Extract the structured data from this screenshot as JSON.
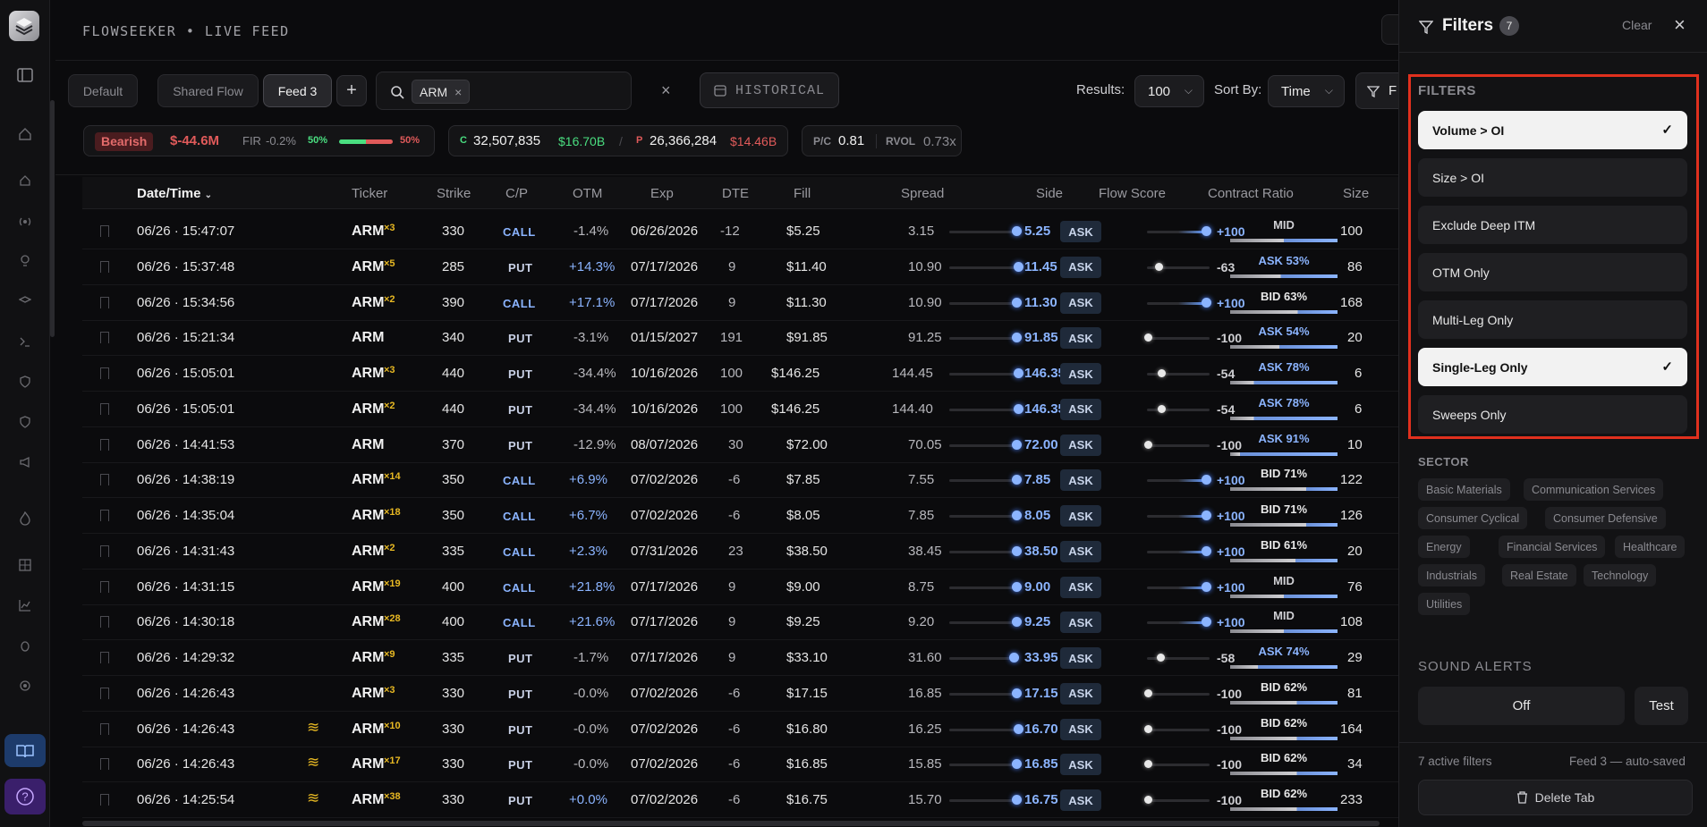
{
  "app": {
    "brand": "FLOWSEEKER • LIVE FEED"
  },
  "tabs": [
    {
      "label": "Default"
    },
    {
      "label": "Shared Flow"
    },
    {
      "label": "Feed 3"
    }
  ],
  "search": {
    "chip": "ARM",
    "historical_label": "HISTORICAL"
  },
  "controls": {
    "results_label": "Results:",
    "results_value": "100",
    "sort_label": "Sort By:",
    "sort_value": "Time",
    "filter_button_partial": "F"
  },
  "summary": {
    "sentiment": "Bearish",
    "net": "$-44.6M",
    "fir_label": "FIR",
    "fir_value": "-0.2%",
    "left_pct": "50%",
    "right_pct": "50%",
    "call_label": "C",
    "call_count": "32,507,835",
    "call_prem": "$16.70B",
    "divider": "/",
    "put_label": "P",
    "put_count": "26,366,284",
    "put_prem": "$14.46B",
    "pc_label": "P/C",
    "pc_value": "0.81",
    "rvol_label": "RVOL",
    "rvol_value": "0.73x"
  },
  "columns": [
    "Date/Time",
    "Ticker",
    "Strike",
    "C/P",
    "OTM",
    "Exp",
    "DTE",
    "Fill",
    "Spread",
    "Side",
    "Flow Score",
    "Contract Ratio",
    "Size"
  ],
  "rows": [
    {
      "dt": "06/26 · 15:47:07",
      "ticker": "ARM",
      "mult": "×3",
      "sweep": "",
      "strike": "330",
      "cp": "CALL",
      "otm": "-1.4%",
      "exp": "06/26/2026",
      "dte": "-12",
      "fill": "$5.25",
      "spread": "3.15",
      "last": "5.25",
      "side": "ASK",
      "score": "+100",
      "ratio": "MID",
      "size": "100"
    },
    {
      "dt": "06/26 · 15:37:48",
      "ticker": "ARM",
      "mult": "×5",
      "sweep": "",
      "strike": "285",
      "cp": "PUT",
      "otm": "+14.3%",
      "exp": "07/17/2026",
      "dte": "9",
      "fill": "$11.40",
      "spread": "10.90",
      "last": "11.45",
      "side": "ASK",
      "score": "-63",
      "ratio": "ASK 53%",
      "size": "86"
    },
    {
      "dt": "06/26 · 15:34:56",
      "ticker": "ARM",
      "mult": "×2",
      "sweep": "",
      "strike": "390",
      "cp": "CALL",
      "otm": "+17.1%",
      "exp": "07/17/2026",
      "dte": "9",
      "fill": "$11.30",
      "spread": "10.90",
      "last": "11.30",
      "side": "ASK",
      "score": "+100",
      "ratio": "BID 63%",
      "size": "168"
    },
    {
      "dt": "06/26 · 15:21:34",
      "ticker": "ARM",
      "mult": "",
      "sweep": "",
      "strike": "340",
      "cp": "PUT",
      "otm": "-3.1%",
      "exp": "01/15/2027",
      "dte": "191",
      "fill": "$91.85",
      "spread": "91.25",
      "last": "91.85",
      "side": "ASK",
      "score": "-100",
      "ratio": "ASK 54%",
      "size": "20"
    },
    {
      "dt": "06/26 · 15:05:01",
      "ticker": "ARM",
      "mult": "×3",
      "sweep": "",
      "strike": "440",
      "cp": "PUT",
      "otm": "-34.4%",
      "exp": "10/16/2026",
      "dte": "100",
      "fill": "$146.25",
      "spread": "144.45",
      "last": "146.35",
      "side": "ASK",
      "score": "-54",
      "ratio": "ASK 78%",
      "size": "6"
    },
    {
      "dt": "06/26 · 15:05:01",
      "ticker": "ARM",
      "mult": "×2",
      "sweep": "",
      "strike": "440",
      "cp": "PUT",
      "otm": "-34.4%",
      "exp": "10/16/2026",
      "dte": "100",
      "fill": "$146.25",
      "spread": "144.40",
      "last": "146.35",
      "side": "ASK",
      "score": "-54",
      "ratio": "ASK 78%",
      "size": "6"
    },
    {
      "dt": "06/26 · 14:41:53",
      "ticker": "ARM",
      "mult": "",
      "sweep": "",
      "strike": "370",
      "cp": "PUT",
      "otm": "-12.9%",
      "exp": "08/07/2026",
      "dte": "30",
      "fill": "$72.00",
      "spread": "70.05",
      "last": "72.00",
      "side": "ASK",
      "score": "-100",
      "ratio": "ASK 91%",
      "size": "10"
    },
    {
      "dt": "06/26 · 14:38:19",
      "ticker": "ARM",
      "mult": "×14",
      "sweep": "",
      "strike": "350",
      "cp": "CALL",
      "otm": "+6.9%",
      "exp": "07/02/2026",
      "dte": "-6",
      "fill": "$7.85",
      "spread": "7.55",
      "last": "7.85",
      "side": "ASK",
      "score": "+100",
      "ratio": "BID 71%",
      "size": "122"
    },
    {
      "dt": "06/26 · 14:35:04",
      "ticker": "ARM",
      "mult": "×18",
      "sweep": "",
      "strike": "350",
      "cp": "CALL",
      "otm": "+6.7%",
      "exp": "07/02/2026",
      "dte": "-6",
      "fill": "$8.05",
      "spread": "7.85",
      "last": "8.05",
      "side": "ASK",
      "score": "+100",
      "ratio": "BID 71%",
      "size": "126"
    },
    {
      "dt": "06/26 · 14:31:43",
      "ticker": "ARM",
      "mult": "×2",
      "sweep": "",
      "strike": "335",
      "cp": "CALL",
      "otm": "+2.3%",
      "exp": "07/31/2026",
      "dte": "23",
      "fill": "$38.50",
      "spread": "38.45",
      "last": "38.50",
      "side": "ASK",
      "score": "+100",
      "ratio": "BID 61%",
      "size": "20"
    },
    {
      "dt": "06/26 · 14:31:15",
      "ticker": "ARM",
      "mult": "×19",
      "sweep": "",
      "strike": "400",
      "cp": "CALL",
      "otm": "+21.8%",
      "exp": "07/17/2026",
      "dte": "9",
      "fill": "$9.00",
      "spread": "8.75",
      "last": "9.00",
      "side": "ASK",
      "score": "+100",
      "ratio": "MID",
      "size": "76"
    },
    {
      "dt": "06/26 · 14:30:18",
      "ticker": "ARM",
      "mult": "×28",
      "sweep": "",
      "strike": "400",
      "cp": "CALL",
      "otm": "+21.6%",
      "exp": "07/17/2026",
      "dte": "9",
      "fill": "$9.25",
      "spread": "9.20",
      "last": "9.25",
      "side": "ASK",
      "score": "+100",
      "ratio": "MID",
      "size": "108"
    },
    {
      "dt": "06/26 · 14:29:32",
      "ticker": "ARM",
      "mult": "×9",
      "sweep": "",
      "strike": "335",
      "cp": "PUT",
      "otm": "-1.7%",
      "exp": "07/17/2026",
      "dte": "9",
      "fill": "$33.10",
      "spread": "31.60",
      "last": "33.95",
      "side": "ASK",
      "score": "-58",
      "ratio": "ASK 74%",
      "size": "29"
    },
    {
      "dt": "06/26 · 14:26:43",
      "ticker": "ARM",
      "mult": "×3",
      "sweep": "",
      "strike": "330",
      "cp": "PUT",
      "otm": "-0.0%",
      "exp": "07/02/2026",
      "dte": "-6",
      "fill": "$17.15",
      "spread": "16.85",
      "last": "17.15",
      "side": "ASK",
      "score": "-100",
      "ratio": "BID 62%",
      "size": "81"
    },
    {
      "dt": "06/26 · 14:26:43",
      "ticker": "ARM",
      "mult": "×10",
      "sweep": "≋",
      "strike": "330",
      "cp": "PUT",
      "otm": "-0.0%",
      "exp": "07/02/2026",
      "dte": "-6",
      "fill": "$16.80",
      "spread": "16.25",
      "last": "16.70",
      "side": "ASK",
      "score": "-100",
      "ratio": "BID 62%",
      "size": "164"
    },
    {
      "dt": "06/26 · 14:26:43",
      "ticker": "ARM",
      "mult": "×17",
      "sweep": "≋",
      "strike": "330",
      "cp": "PUT",
      "otm": "-0.0%",
      "exp": "07/02/2026",
      "dte": "-6",
      "fill": "$16.85",
      "spread": "15.85",
      "last": "16.85",
      "side": "ASK",
      "score": "-100",
      "ratio": "BID 62%",
      "size": "34"
    },
    {
      "dt": "06/26 · 14:25:54",
      "ticker": "ARM",
      "mult": "×38",
      "sweep": "≋",
      "strike": "330",
      "cp": "PUT",
      "otm": "+0.0%",
      "exp": "07/02/2026",
      "dte": "-6",
      "fill": "$16.75",
      "spread": "15.70",
      "last": "16.75",
      "side": "ASK",
      "score": "-100",
      "ratio": "BID 62%",
      "size": "233"
    }
  ],
  "panel": {
    "title": "Filters",
    "count": "7",
    "clear": "Clear",
    "filters_heading": "FILTERS",
    "options": [
      {
        "label": "Volume > OI",
        "on": true
      },
      {
        "label": "Size > OI",
        "on": false
      },
      {
        "label": "Exclude Deep ITM",
        "on": false
      },
      {
        "label": "OTM Only",
        "on": false
      },
      {
        "label": "Multi-Leg Only",
        "on": false
      },
      {
        "label": "Single-Leg Only",
        "on": true
      },
      {
        "label": "Sweeps Only",
        "on": false
      }
    ],
    "sector_heading": "SECTOR",
    "sectors": [
      "Basic Materials",
      "Communication Services",
      "Consumer Cyclical",
      "Consumer Defensive",
      "Energy",
      "Financial Services",
      "Healthcare",
      "Industrials",
      "Real Estate",
      "Technology",
      "Utilities"
    ],
    "sound_heading": "SOUND ALERTS",
    "sound_off": "Off",
    "sound_test": "Test",
    "active_filters": "7 active filters",
    "saved": "Feed 3 — auto-saved",
    "delete_tab": "Delete Tab"
  },
  "colors": {
    "accent_blue": "#8bb4ff",
    "bearish_red": "#e05a5a",
    "highlight_border": "#e0301e",
    "gold": "#e8b923"
  }
}
